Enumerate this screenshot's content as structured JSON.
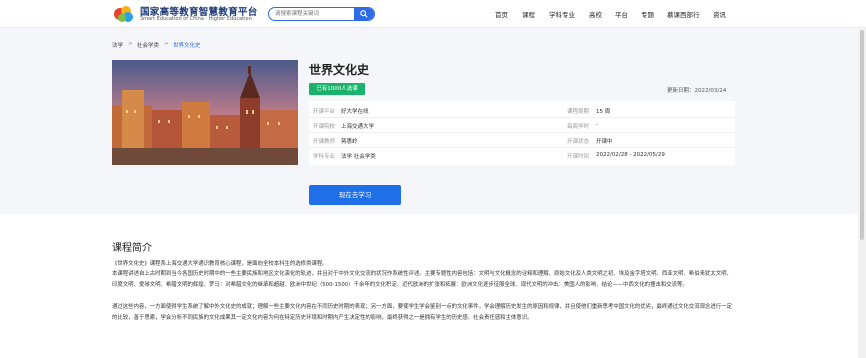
{
  "header": {
    "logo_cn": "国家高等教育智慧教育平台",
    "logo_en": "Smart Education of China · Higher Education",
    "search_placeholder": "请搜索课程关键词",
    "nav": [
      "首页",
      "课程",
      "学科专业",
      "高校",
      "平台",
      "专题",
      "慕课西部行",
      "资讯"
    ]
  },
  "breadcrumb": [
    "法学",
    "社会学类",
    "世界文化史"
  ],
  "course": {
    "title": "世界文化史",
    "badge": "已有1000人选课",
    "update_label": "更新日期：2022/03/24",
    "info": [
      {
        "label": "开课平台",
        "value": "好大学在线",
        "label2": "课程周期",
        "value2": "15 周"
      },
      {
        "label": "开课院校",
        "value": "上海交通大学",
        "label2": "每周学时",
        "value2": "-"
      },
      {
        "label": "开课教师",
        "value": "蒋惠岭",
        "label2": "开课状态",
        "value2": "开课中"
      },
      {
        "label": "学科专业",
        "value": "法学 社会学类",
        "label2": "开课时间",
        "value2": "2022/02/28 - 2022/05/29"
      }
    ],
    "cta": "现在去学习"
  },
  "intro": {
    "title": "课程简介",
    "paragraphs": [
      "《世界文化史》课程系上海交通大学通识教育核心课程，是面向全校本科生的选修类课程。",
      "本课程讲述自上古时期到当今各国历史时期中的一些主要民族和地区文化演化的轨迹，并且对于中外文化交流的状况作系统性评述。主要专题性内容包括：文明与文化概念的诠释和理解、原始文化及人类文明之初、埃及金字塔文明、西亚文明、希伯来犹太文明、印度文明、爱琴文明、希腊文明的辉煌、罗马：对希腊文化的继承和超越、欧洲中世纪（500-1500）千余年的文化积淀、近代欧洲的扩张和拓展：欧洲文化逐步征服全球、现代文明的冲击：美国人的影响、结论——中西文化的撞击和交流等。",
      "通过这些内容，一方面使得学生系统了解中外文化史的成就；理解一些主要文化内容在不同历史时期的表现；另一方面，要使学生学会鉴别一点的文化事件，学会理解历史发生的原因和规律，并且使他们重新思考中国文化的优劣，最终通过文化交流观念进行一定的比较，善于思索，学会分析不同民族的文化成果其一定文化内容为何在特定历史环境和时期内产生决定性的影响，最终获得之一是拥有学生的历史感、社会责任感和主体意识。"
    ]
  },
  "colors": {
    "accent": "#1f6fe8",
    "badge": "#19b36b",
    "band": "#f5f6f9"
  }
}
